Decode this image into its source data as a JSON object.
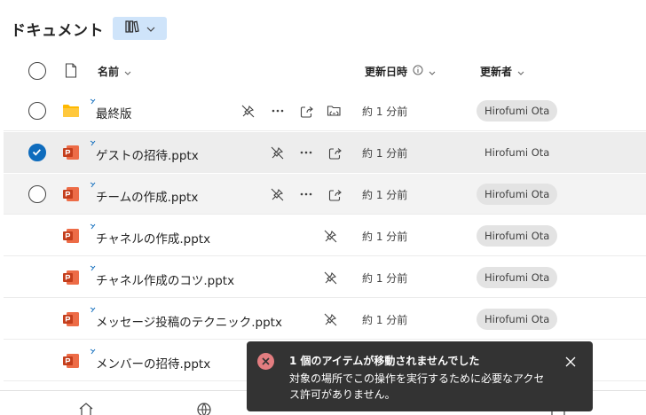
{
  "header": {
    "title": "ドキュメント"
  },
  "columns": {
    "name": "名前",
    "modified": "更新日時",
    "modified_by": "更新者"
  },
  "files": [
    {
      "name": "最終版",
      "type": "folder",
      "modified": "約 1 分前",
      "modified_by": "Hirofumi Ota",
      "selected": false
    },
    {
      "name": "ゲストの招待.pptx",
      "type": "pptx",
      "modified": "約 1 分前",
      "modified_by": "Hirofumi Ota",
      "selected": true
    },
    {
      "name": "チームの作成.pptx",
      "type": "pptx",
      "modified": "約 1 分前",
      "modified_by": "Hirofumi Ota",
      "selected": false
    },
    {
      "name": "チャネルの作成.pptx",
      "type": "pptx",
      "modified": "約 1 分前",
      "modified_by": "Hirofumi Ota",
      "selected": false
    },
    {
      "name": "チャネル作成のコツ.pptx",
      "type": "pptx",
      "modified": "約 1 分前",
      "modified_by": "Hirofumi Ota",
      "selected": false
    },
    {
      "name": "メッセージ投稿のテクニック.pptx",
      "type": "pptx",
      "modified": "約 1 分前",
      "modified_by": "Hirofumi Ota",
      "selected": false
    },
    {
      "name": "メンバーの招待.pptx",
      "type": "pptx",
      "modified": "",
      "modified_by": "",
      "selected": false
    }
  ],
  "toast": {
    "title": "1 個のアイテムが移動されませんでした",
    "message": "対象の場所でこの操作を実行するために必要なアクセス許可がありません。",
    "icon": "error-icon"
  },
  "colors": {
    "accent": "#0f6cbd",
    "folder": "#ffb900",
    "pptx": "#c43e1c",
    "toast_bg": "#333333",
    "toast_error": "#e37d80"
  }
}
